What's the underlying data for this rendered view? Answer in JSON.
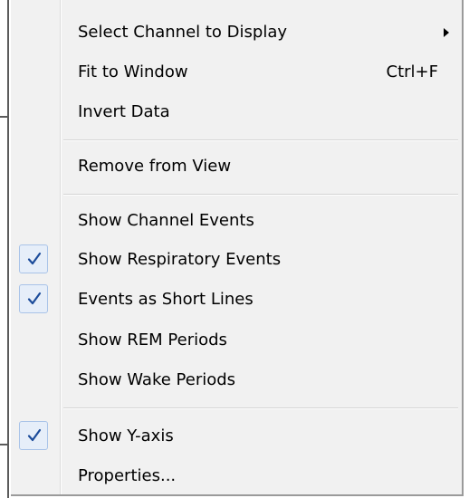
{
  "menu": {
    "items": [
      {
        "label": "Select Channel to Display",
        "checked": false,
        "submenu": true
      },
      {
        "label": "Fit to Window",
        "shortcut": "Ctrl+F",
        "checked": false
      },
      {
        "label": "Invert Data",
        "checked": false
      },
      {
        "label": "Remove from View",
        "checked": false
      },
      {
        "label": "Show Channel Events",
        "checked": false
      },
      {
        "label": "Show Respiratory Events",
        "checked": true
      },
      {
        "label": "Events as Short Lines",
        "checked": true
      },
      {
        "label": "Show REM Periods",
        "checked": false
      },
      {
        "label": "Show Wake Periods",
        "checked": false
      },
      {
        "label": "Show Y-axis",
        "checked": true
      },
      {
        "label": "Properties...",
        "checked": false
      }
    ]
  },
  "colors": {
    "menu_background": "#f1f1f1",
    "check_highlight": "#e6eef9",
    "check_mark": "#1b4b9a"
  }
}
